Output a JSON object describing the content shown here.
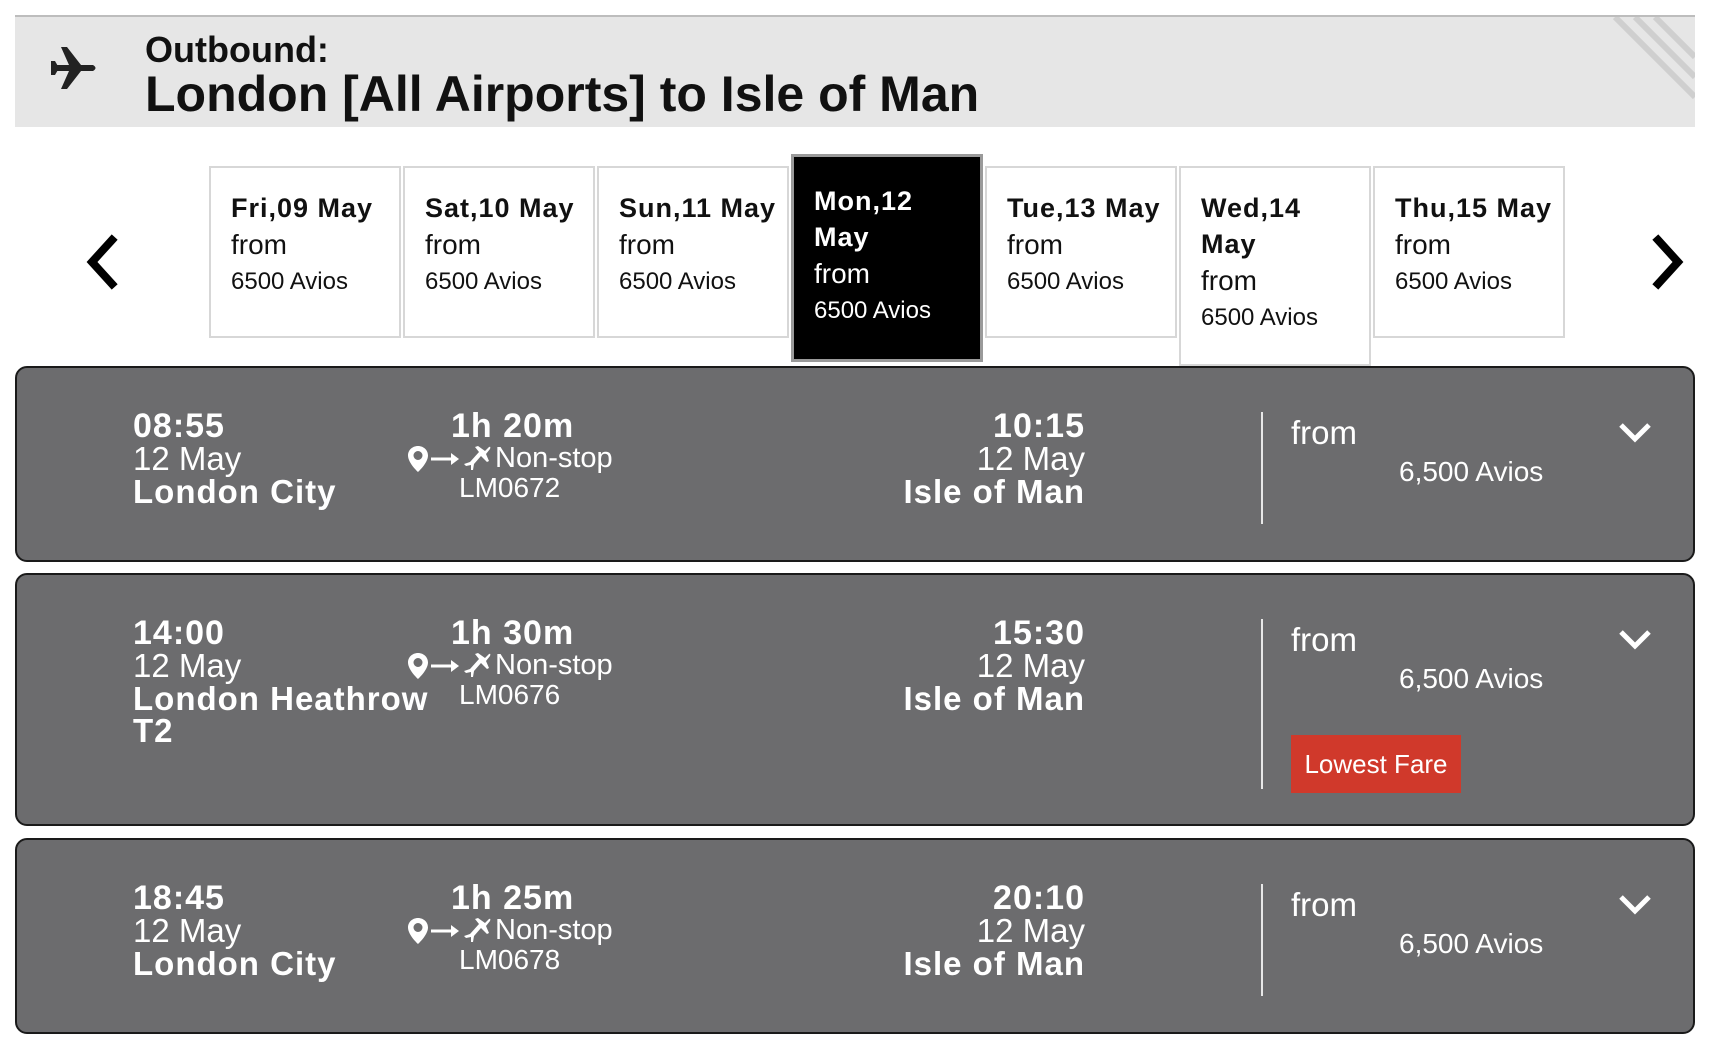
{
  "header": {
    "icon": "plane-icon",
    "label": "Outbound:",
    "route": "London [All Airports] to Isle of Man"
  },
  "date_nav": {
    "prev_icon": "chevron-left-icon",
    "next_icon": "chevron-right-icon",
    "dates": [
      {
        "date": "Fri,09 May",
        "from": "from",
        "price": "6500 Avios",
        "selected": false
      },
      {
        "date": "Sat,10 May",
        "from": "from",
        "price": "6500 Avios",
        "selected": false
      },
      {
        "date": "Sun,11 May",
        "from": "from",
        "price": "6500 Avios",
        "selected": false
      },
      {
        "date": "Mon,12 May",
        "from": "from",
        "price": "6500 Avios",
        "selected": true
      },
      {
        "date": "Tue,13 May",
        "from": "from",
        "price": "6500 Avios",
        "selected": false
      },
      {
        "date": "Wed,14 May",
        "from": "from",
        "price": "6500 Avios",
        "selected": false
      },
      {
        "date": "Thu,15 May",
        "from": "from",
        "price": "6500 Avios",
        "selected": false
      }
    ]
  },
  "flights": [
    {
      "dep_time": "08:55",
      "dep_date": "12 May",
      "dep_city": "London City",
      "duration": "1h 20m",
      "stops": "Non-stop",
      "flight_number": "LM0672",
      "arr_time": "10:15",
      "arr_date": "12 May",
      "arr_city": "Isle of Man",
      "from_label": "from",
      "price": "6,500 Avios",
      "badge": ""
    },
    {
      "dep_time": "14:00",
      "dep_date": "12 May",
      "dep_city": "London Heathrow T2",
      "duration": "1h 30m",
      "stops": "Non-stop",
      "flight_number": "LM0676",
      "arr_time": "15:30",
      "arr_date": "12 May",
      "arr_city": "Isle of Man",
      "from_label": "from",
      "price": "6,500 Avios",
      "badge": "Lowest Fare"
    },
    {
      "dep_time": "18:45",
      "dep_date": "12 May",
      "dep_city": "London City",
      "duration": "1h 25m",
      "stops": "Non-stop",
      "flight_number": "LM0678",
      "arr_time": "20:10",
      "arr_date": "12 May",
      "arr_city": "Isle of Man",
      "from_label": "from",
      "price": "6,500 Avios",
      "badge": ""
    }
  ],
  "colors": {
    "card_bg": "#6c6c6e",
    "selected_tab_bg": "#000000",
    "badge_bg": "#d0392b",
    "header_bg": "#e6e6e6"
  }
}
